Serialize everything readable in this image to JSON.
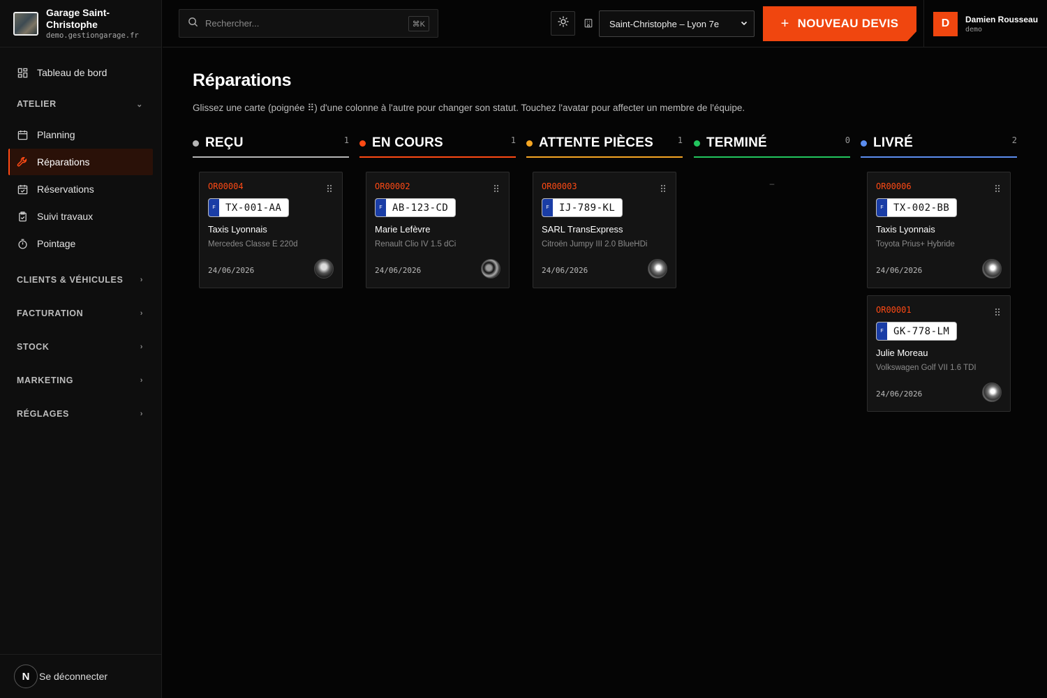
{
  "brand": {
    "name": "Garage Saint-Christophe",
    "domain": "demo.gestiongarage.fr"
  },
  "sidebar": {
    "dashboard": "Tableau de bord",
    "atelier": {
      "label": "ATELIER",
      "items": [
        {
          "label": "Planning"
        },
        {
          "label": "Réparations"
        },
        {
          "label": "Réservations"
        },
        {
          "label": "Suivi travaux"
        },
        {
          "label": "Pointage"
        }
      ]
    },
    "sections": [
      {
        "label": "CLIENTS & VÉHICULES"
      },
      {
        "label": "FACTURATION"
      },
      {
        "label": "STOCK"
      },
      {
        "label": "MARKETING"
      },
      {
        "label": "RÉGLAGES"
      }
    ],
    "logout": "Se déconnecter",
    "badge": "N"
  },
  "topbar": {
    "search_placeholder": "Rechercher...",
    "shortcut": "⌘K",
    "site": "Saint-Christophe – Lyon 7e",
    "new_quote": "NOUVEAU DEVIS",
    "user": {
      "initial": "D",
      "name": "Damien Rousseau",
      "role": "demo"
    }
  },
  "page": {
    "title": "Réparations",
    "description": "Glissez une carte (poignée ⠿) d'une colonne à l'autre pour changer son statut. Touchez l'avatar pour affecter un membre de l'équipe."
  },
  "columns": [
    {
      "title": "REÇU",
      "count": "1",
      "color": "#b5b5b5",
      "cards": [
        {
          "id": "OR00004",
          "eu": "F",
          "plate": "TX-001-AA",
          "client": "Taxis Lyonnais",
          "vehicle": "Mercedes Classe E 220d",
          "date": "24/06/2026"
        }
      ]
    },
    {
      "title": "EN COURS",
      "count": "1",
      "color": "#ff4a14",
      "cards": [
        {
          "id": "OR00002",
          "eu": "F",
          "plate": "AB-123-CD",
          "client": "Marie Lefèvre",
          "vehicle": "Renault Clio IV 1.5 dCi",
          "date": "24/06/2026"
        }
      ]
    },
    {
      "title": "ATTENTE PIÈCES",
      "count": "1",
      "color": "#f5a623",
      "cards": [
        {
          "id": "OR00003",
          "eu": "F",
          "plate": "IJ-789-KL",
          "client": "SARL TransExpress",
          "vehicle": "Citroën Jumpy III 2.0 BlueHDi",
          "date": "24/06/2026"
        }
      ]
    },
    {
      "title": "TERMINÉ",
      "count": "0",
      "color": "#22c55e",
      "empty": "–",
      "cards": []
    },
    {
      "title": "LIVRÉ",
      "count": "2",
      "color": "#5b8def",
      "cards": [
        {
          "id": "OR00006",
          "eu": "F",
          "plate": "TX-002-BB",
          "client": "Taxis Lyonnais",
          "vehicle": "Toyota Prius+ Hybride",
          "date": "24/06/2026"
        },
        {
          "id": "OR00001",
          "eu": "F",
          "plate": "GK-778-LM",
          "client": "Julie Moreau",
          "vehicle": "Volkswagen Golf VII 1.6 TDI",
          "date": "24/06/2026"
        }
      ]
    }
  ]
}
